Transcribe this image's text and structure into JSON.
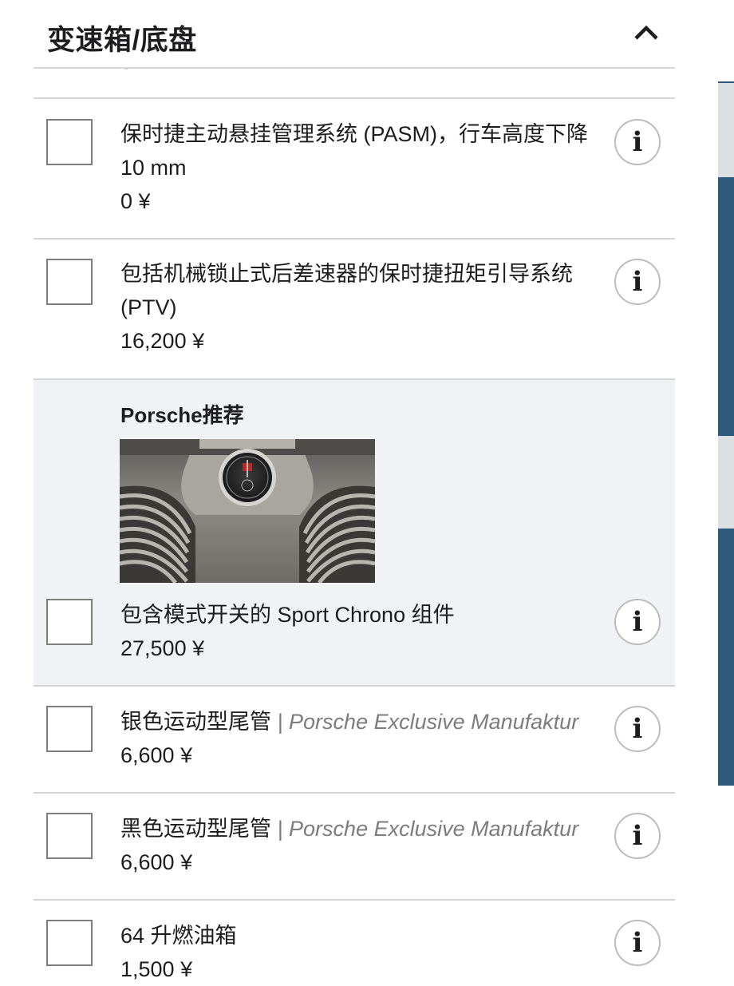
{
  "section": {
    "title": "变速箱/底盘"
  },
  "options": [
    {
      "name": "保时捷主动悬挂管理系统 (PASM)，行车高度下降 10 mm",
      "price": "0 ¥"
    },
    {
      "name": "包括机械锁止式后差速器的保时捷扭矩引导系统 (PTV)",
      "price": "16,200 ¥"
    }
  ],
  "recommendation": {
    "label": "Porsche推荐",
    "image_alt": "Sport Chrono dashboard clock",
    "option": {
      "name": "包含模式开关的 Sport Chrono 组件",
      "price": "27,500 ¥"
    }
  },
  "options_after": [
    {
      "name": "银色运动型尾管",
      "brand": "| Porsche Exclusive Manufaktur",
      "price": "6,600 ¥"
    },
    {
      "name": "黑色运动型尾管",
      "brand": "| Porsche Exclusive Manufaktur",
      "price": "6,600 ¥"
    },
    {
      "name": "64 升燃油箱",
      "price": "1,500 ¥"
    }
  ],
  "icons": {
    "info": "i",
    "collapse": "chevron-up-icon"
  },
  "colors": {
    "highlight_bg": "#f1f2f5",
    "side_strip": "#2e5a7e",
    "brand_text": "#7c7c7c"
  }
}
